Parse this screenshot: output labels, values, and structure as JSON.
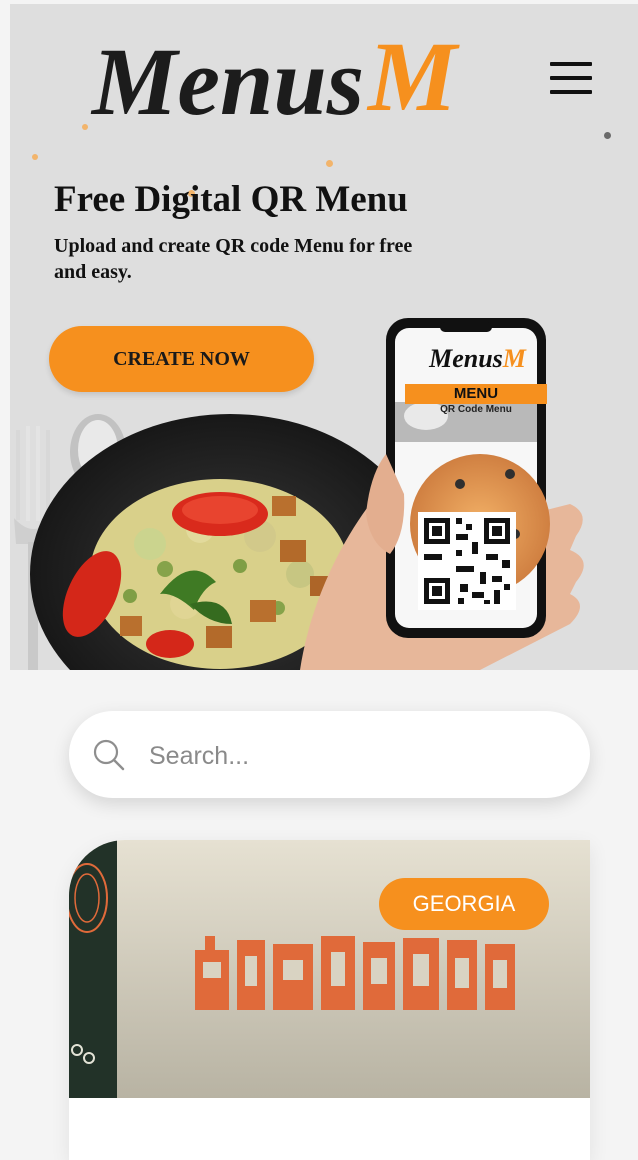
{
  "header": {
    "logo_text": "Menus",
    "logo_mark": "M",
    "menu_icon": "hamburger-icon"
  },
  "hero": {
    "title": "Free Digital QR Menu",
    "subtitle": "Upload and create QR code Menu for free and easy.",
    "cta_label": "CREATE NOW",
    "phone_logo_text": "Menus",
    "phone_logo_mark": "M",
    "phone_menu_label": "MENU",
    "phone_menu_sub": "QR Code Menu"
  },
  "search": {
    "placeholder": "Search...",
    "icon": "search-icon"
  },
  "card": {
    "badge": "GEORGIA",
    "colors": {
      "badge": "#f6901e",
      "banner_bg": "#d6d0bf",
      "banner_text": "#e06a3a",
      "panel": "#223228"
    }
  },
  "colors": {
    "accent": "#f6901e",
    "hero_bg": "#dedede",
    "page_bg": "#f4f4f4"
  }
}
